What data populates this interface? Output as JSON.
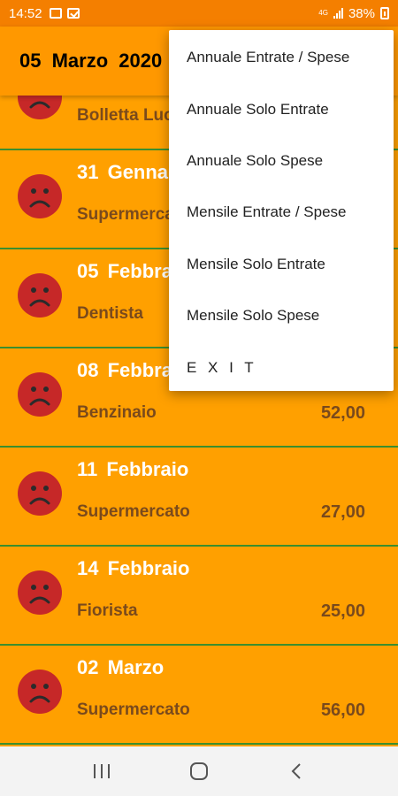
{
  "status_bar": {
    "time": "14:52",
    "network": "4G",
    "battery": "38%"
  },
  "app_bar": {
    "title": "05  Marzo  2020"
  },
  "rows": [
    {
      "date": "",
      "description": "Bolletta Luce",
      "amount": ""
    },
    {
      "date": "31  Gennaio",
      "description": "Supermercato",
      "amount": ""
    },
    {
      "date": "05  Febbraio",
      "description": "Dentista",
      "amount": ""
    },
    {
      "date": "08  Febbraio",
      "description": "Benzinaio",
      "amount": "52,00"
    },
    {
      "date": "11  Febbraio",
      "description": "Supermercato",
      "amount": "27,00"
    },
    {
      "date": "14  Febbraio",
      "description": "Fiorista",
      "amount": "25,00"
    },
    {
      "date": "02  Marzo",
      "description": "Supermercato",
      "amount": "56,00"
    }
  ],
  "menu": {
    "items": [
      "Annuale Entrate / Spese",
      "Annuale Solo Entrate",
      "Annuale Solo Spese",
      "Mensile Entrate / Spese",
      "Mensile Solo Entrate",
      "Mensile Solo Spese",
      "E X I T"
    ]
  },
  "colors": {
    "primary": "#FF9800",
    "status_bar": "#F47F00",
    "divider": "#3B8E2E",
    "sad_icon": "#C62828",
    "text_brown": "#7A4A1C"
  },
  "icons": {
    "row_icon": "sad-face-icon",
    "nav": [
      "recent-apps-icon",
      "home-icon",
      "back-icon"
    ]
  }
}
